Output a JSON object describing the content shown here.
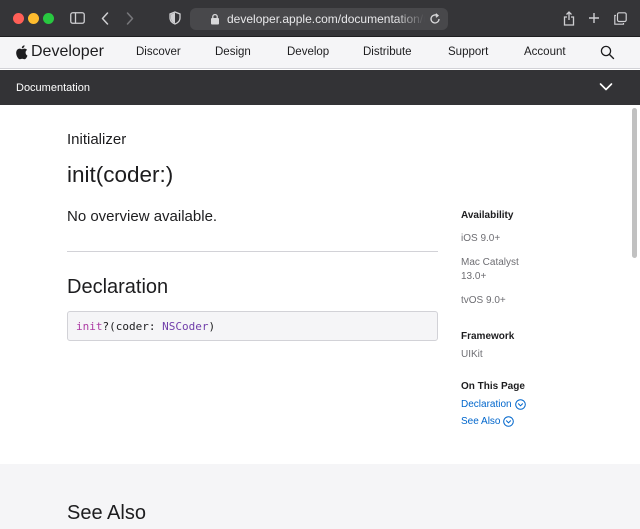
{
  "browser": {
    "url": "developer.apple.com/documentation/uikit/uiview"
  },
  "globalnav": {
    "brand": "Developer",
    "items": [
      "Discover",
      "Design",
      "Develop",
      "Distribute",
      "Support",
      "Account"
    ]
  },
  "docbar": {
    "title": "Documentation"
  },
  "main": {
    "eyebrow": "Initializer",
    "title": "init(coder:)",
    "overview": "No overview available.",
    "declaration_heading": "Declaration",
    "code": {
      "keyword": "init",
      "open": "?(coder: ",
      "type": "NSCoder",
      "close": ")"
    },
    "see_also_heading": "See Also"
  },
  "sidebar": {
    "availability_heading": "Availability",
    "platforms": [
      "iOS 9.0+",
      "Mac Catalyst 13.0+",
      "tvOS 9.0+"
    ],
    "framework_heading": "Framework",
    "framework": "UIKit",
    "on_this_page_heading": "On This Page",
    "links": [
      "Declaration",
      "See Also"
    ]
  },
  "colors": {
    "link": "#0066cc",
    "keyword": "#ad3da4",
    "type": "#703daa",
    "chrome": "#353538",
    "docbar": "#333336"
  }
}
